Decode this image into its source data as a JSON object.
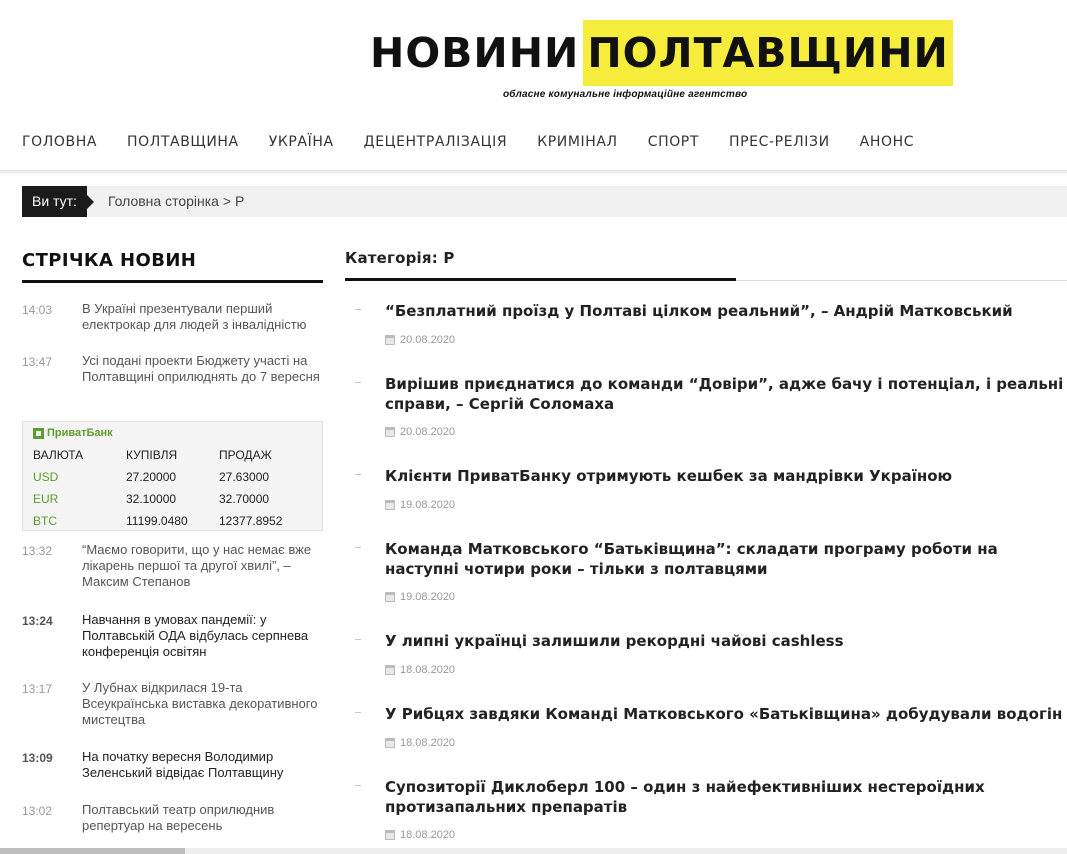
{
  "header": {
    "logo_part1": "НОВИНИ",
    "logo_part2": "ПОЛТАВЩИНИ",
    "tagline": "обласне комунальне інформаційне агентство",
    "accent_color": "#f6ec3c"
  },
  "nav": [
    "ГОЛОВНА",
    "ПОЛТАВЩИНА",
    "УКРАЇНА",
    "ДЕЦЕНТРАЛІЗАЦІЯ",
    "КРИМІНАЛ",
    "СПОРТ",
    "ПРЕС-РЕЛІЗИ",
    "АНОНС"
  ],
  "breadcrumb": {
    "label": "Ви тут:",
    "home": "Головна сторінка",
    "separator": ">",
    "current": "Р"
  },
  "feed": {
    "title": "СТРІЧКА НОВИН",
    "items": [
      {
        "time": "14:03",
        "text": "В Україні презентували перший електрокар для людей з інвалідністю"
      },
      {
        "time": "13:47",
        "text": "Усі подані проекти Бюджету участі на Полтавщині оприлюднять до 7 вересня"
      },
      {
        "time": "13:32",
        "text": "“Маємо говорити, що у нас немає вже лікарень першої та другої хвилі”, – Максим Степанов"
      },
      {
        "time": "13:24",
        "text": "Навчання в умовах пандемії: у Полтавській ОДА відбулась серпнева конференція освітян"
      },
      {
        "time": "13:17",
        "text": "У Лубнах відкрилася 19-та Всеукраїнська виставка декоративного мистецтва"
      },
      {
        "time": "13:09",
        "text": "На початку вересня Володимир Зеленський відвідає Полтавщину"
      },
      {
        "time": "13:02",
        "text": "Полтавський театр оприлюднив репертуар на вересень"
      }
    ]
  },
  "bank": {
    "name": "ПриватБанк",
    "headers": [
      "ВАЛЮТА",
      "КУПІВЛЯ",
      "ПРОДАЖ"
    ],
    "rows": [
      [
        "USD",
        "27.20000",
        "27.63000"
      ],
      [
        "EUR",
        "32.10000",
        "32.70000"
      ],
      [
        "BTC",
        "11199.0480",
        "12377.8952"
      ]
    ],
    "brand_color": "#5e9c2e"
  },
  "category": {
    "title": "Категорія: Р",
    "articles": [
      {
        "title": "“Безплатний проїзд у Полтаві цілком реальний”, – Андрій Матковський",
        "date": "20.08.2020"
      },
      {
        "title": "Вирішив приєднатися до команди “Довіри”, адже бачу і потенціал, і реальні справи, – Сергій Соломаха",
        "date": "20.08.2020"
      },
      {
        "title": "Клієнти ПриватБанку отримують кешбек за мандрівки Україною",
        "date": "19.08.2020"
      },
      {
        "title": "Команда Матковського “Батьківщина”: складати програму роботи на наступні чотири роки – тільки з полтавцями",
        "date": "19.08.2020"
      },
      {
        "title": "У липні українці залишили рекордні чайові cashless",
        "date": "18.08.2020"
      },
      {
        "title": "У Рибцях завдяки Команді Матковського «Батьківщина» добудували водогін",
        "date": "18.08.2020"
      },
      {
        "title": "Супозиторії Диклоберл 100 – один з найефективніших нестероїдних протизапальних препаратів",
        "date": "18.08.2020"
      }
    ]
  }
}
